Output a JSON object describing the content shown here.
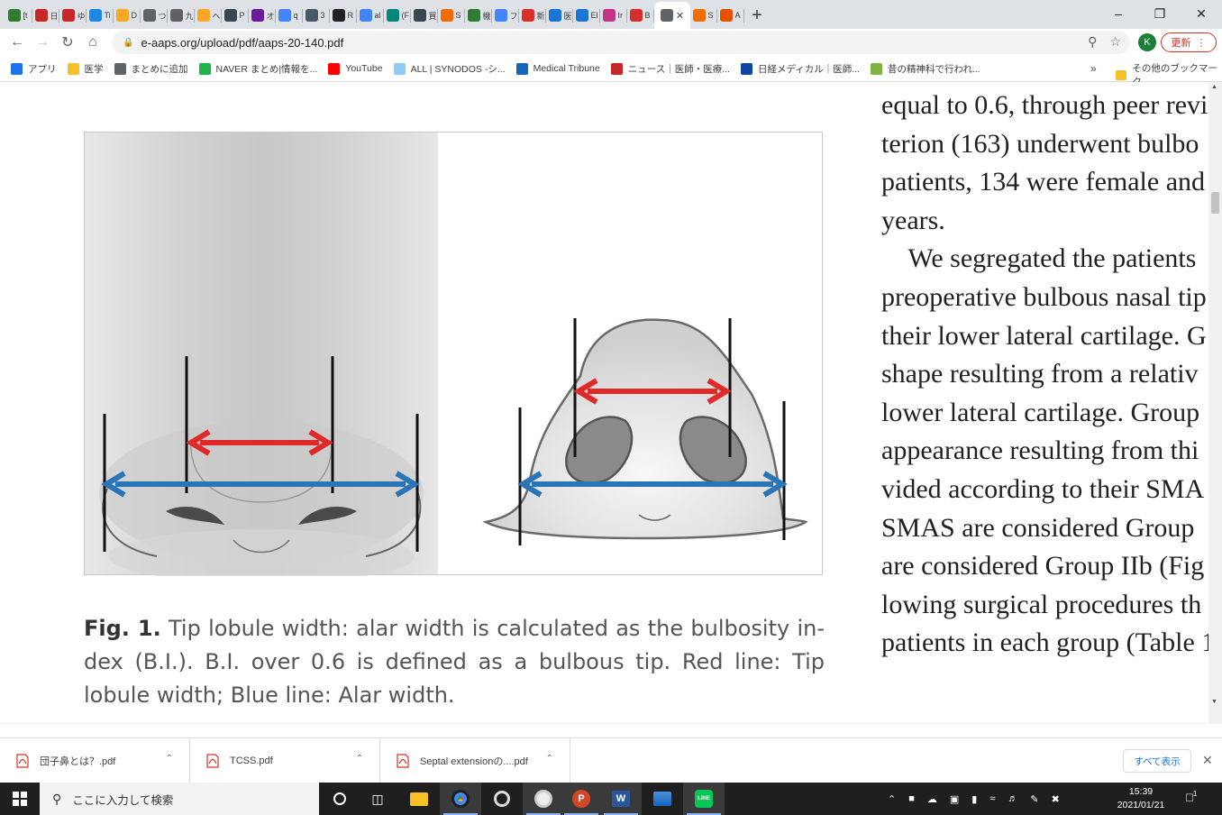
{
  "browser": {
    "tabs": [
      {
        "label": "[t",
        "icon": "green-robot-icon",
        "color": "#2e7d32"
      },
      {
        "label": "日",
        "icon": "red-favicon-icon",
        "color": "#c62828"
      },
      {
        "label": "ゆ",
        "icon": "red-favicon-icon",
        "color": "#c62828"
      },
      {
        "label": "Ti",
        "icon": "blue-circle-icon",
        "color": "#1e88e5"
      },
      {
        "label": "D",
        "icon": "orange-square-icon",
        "color": "#f9a825"
      },
      {
        "label": "つ",
        "icon": "globe-icon",
        "color": "#5f6368"
      },
      {
        "label": "九",
        "icon": "stripes-icon",
        "color": "#616161"
      },
      {
        "label": "へ",
        "icon": "orange-square-icon",
        "color": "#f9a825"
      },
      {
        "label": "P",
        "icon": "double-chevron-icon",
        "color": "#37474f"
      },
      {
        "label": "オ",
        "icon": "purple-c-icon",
        "color": "#6a1b9a"
      },
      {
        "label": "q",
        "icon": "google-icon",
        "color": "#4285f4"
      },
      {
        "label": "3",
        "icon": "swirl-icon",
        "color": "#455a64"
      },
      {
        "label": "R",
        "icon": "runner-icon",
        "color": "#212121"
      },
      {
        "label": "al",
        "icon": "google-icon",
        "color": "#4285f4"
      },
      {
        "label": "(F",
        "icon": "r-icon",
        "color": "#00897b"
      },
      {
        "label": "買",
        "icon": "double-chevron-icon",
        "color": "#37474f"
      },
      {
        "label": "S",
        "icon": "fire-icon",
        "color": "#ef6c00"
      },
      {
        "label": "機",
        "icon": "green-cross-icon",
        "color": "#2e7d32"
      },
      {
        "label": "フ",
        "icon": "google-icon",
        "color": "#4285f4"
      },
      {
        "label": "新",
        "icon": "gmail-icon",
        "color": "#d93025"
      },
      {
        "label": "医",
        "icon": "blue-logo-icon",
        "color": "#1976d2"
      },
      {
        "label": "El",
        "icon": "blue-logo-icon",
        "color": "#1976d2"
      },
      {
        "label": "Ir",
        "icon": "instagram-icon",
        "color": "#c13584"
      },
      {
        "label": "B",
        "icon": "red-logo-icon",
        "color": "#d32f2f"
      },
      {
        "label": "",
        "icon": "globe-icon",
        "color": "#5f6368",
        "active": true
      },
      {
        "label": "S",
        "icon": "fire-icon",
        "color": "#ef6c00"
      },
      {
        "label": "A",
        "icon": "e-icon",
        "color": "#e65100"
      }
    ],
    "url": "e-aaps.org/upload/pdf/aaps-20-140.pdf",
    "profile_initial": "K",
    "update_label": "更新",
    "bookmarks": [
      {
        "label": "アプリ",
        "icon": "apps-grid-icon",
        "color": "#1a73e8"
      },
      {
        "label": "医学",
        "icon": "folder-icon",
        "color": "#f6c026"
      },
      {
        "label": "まとめに追加",
        "icon": "globe-icon",
        "color": "#5f6368"
      },
      {
        "label": "NAVER まとめ|情報を...",
        "icon": "naver-icon",
        "color": "#22b24c"
      },
      {
        "label": "YouTube",
        "icon": "youtube-icon",
        "color": "#ff0000"
      },
      {
        "label": "ALL | SYNODOS -シ...",
        "icon": "synodos-icon",
        "color": "#90caf9"
      },
      {
        "label": "Medical Tribune",
        "icon": "m-icon",
        "color": "#1565c0"
      },
      {
        "label": "ニュース｜医師・医療...",
        "icon": "c-icon",
        "color": "#c62828"
      },
      {
        "label": "日経メディカル｜医師...",
        "icon": "nikkei-icon",
        "color": "#0d47a1"
      },
      {
        "label": "昔の精神科で行われ...",
        "icon": "leaf-icon",
        "color": "#7cb342"
      }
    ],
    "bookmarks_more": "»",
    "other_bookmarks": "その他のブックマーク"
  },
  "document": {
    "figure_label": "Fig. 1.",
    "caption": " Tip lobule width: alar width is calculated as the bulbosity in-dex (B.I.). B.I. over 0.6 is defined as a bulbous tip. Red line: Tip lobule width; Blue line: Alar width.",
    "body_lines": [
      "equal to 0.6, through peer revi",
      "terion (163) underwent bulbo",
      "patients, 134 were female and",
      "years.",
      "    We segregated the patients",
      "preoperative bulbous nasal tip",
      "their lower lateral cartilage. G",
      "shape resulting from a relativ",
      "lower lateral cartilage. Group",
      "appearance resulting from thi",
      "vided according to their SMA",
      "SMAS are considered Group",
      "are considered Group IIb (Fig",
      "lowing surgical procedures th",
      "patients in each group (Table 1"
    ],
    "colors": {
      "red_line": "#e02a2a",
      "blue_line": "#2a74b8"
    }
  },
  "downloads": {
    "items": [
      {
        "name": "団子鼻とは？.pdf"
      },
      {
        "name": "TCSS.pdf"
      },
      {
        "name": "Septal extensionの....pdf"
      }
    ],
    "show_all": "すべて表示"
  },
  "taskbar": {
    "search_placeholder": "ここに入力して検索",
    "time": "15:39",
    "date": "2021/01/21",
    "notification_count": "1"
  }
}
